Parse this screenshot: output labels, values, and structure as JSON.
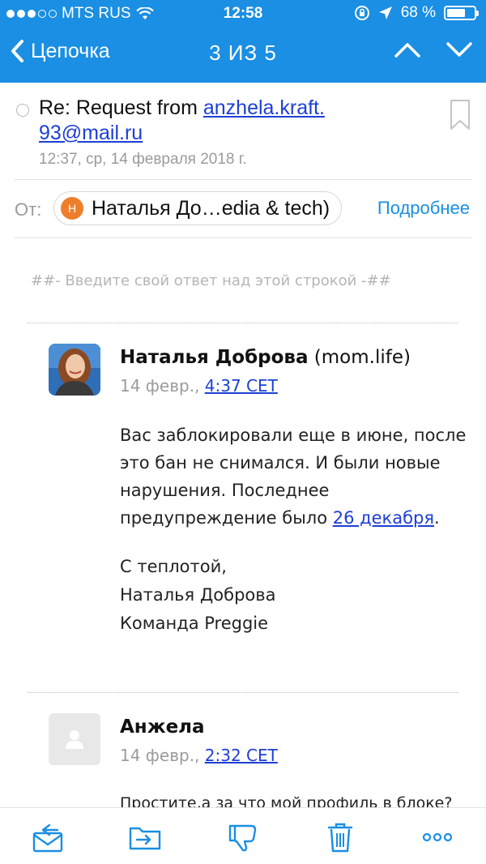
{
  "status": {
    "carrier": "MTS RUS",
    "time": "12:58",
    "battery": "68 %",
    "battery_level": 0.68
  },
  "nav": {
    "back_label": "Цепочка",
    "pager": "3 ИЗ 5"
  },
  "email": {
    "subject_prefix": "Re: Request from ",
    "subject_link_line1": "anzhela.kraft.",
    "subject_link_line2": "93@mail.ru",
    "date": "12:37, ср, 14 февраля 2018 г.",
    "from_label": "От:",
    "sender_initial": "Н",
    "sender_name": "Наталья До…edia & tech)",
    "details": "Подробнее",
    "reply_hint": "##- Введите свой ответ над этой строкой -##"
  },
  "messages": [
    {
      "name_bold": "Наталья Доброва",
      "name_rest": " (mom.life)",
      "date_prefix": "14 февр., ",
      "time_link": "4:37 CET",
      "body_text": "Вас заблокировали еще в июне, после это бан не снимался. И были новые нарушения. Последнее предупреждение было ",
      "body_link": "26 декабря",
      "body_end": ".",
      "sig_line1": "С теплотой,",
      "sig_line2": "Наталья Доброва",
      "sig_line3": "Команда Preggie"
    },
    {
      "name_bold": "Анжела",
      "date_prefix": "14 февр., ",
      "time_link": "2:32 CET",
      "body_text": "Простите,а за что мой профиль в блоке?"
    }
  ],
  "toolbar": {
    "icons": [
      "reply-all-icon",
      "move-icon",
      "spam-icon",
      "trash-icon",
      "more-icon"
    ]
  },
  "colors": {
    "header": "#1a8fe3",
    "link": "#1d3fd4",
    "accent": "#1a8fe3",
    "chip_avatar": "#ef7e2c"
  }
}
